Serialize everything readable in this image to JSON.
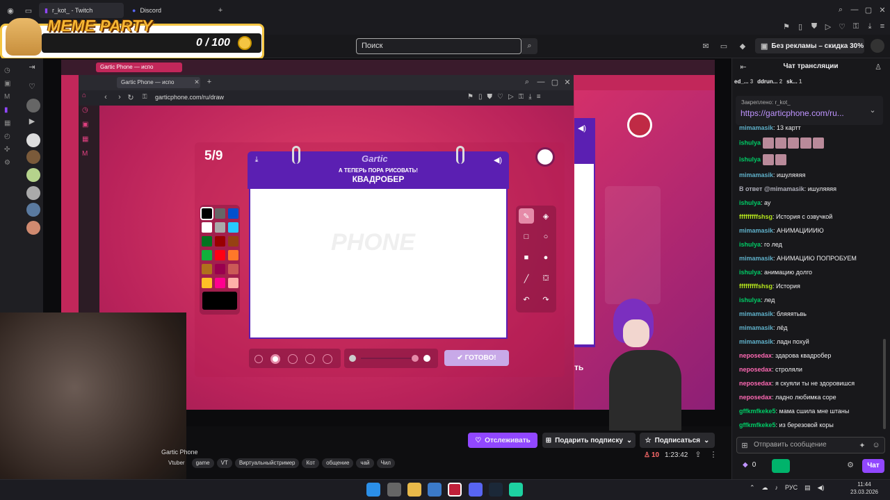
{
  "browser": {
    "tabs": [
      {
        "label": "r_kot_ - Twitch"
      },
      {
        "label": "Discord"
      }
    ],
    "new_tab": "+"
  },
  "meme_party": {
    "title": "MEME PARTY",
    "counter": "0 / 100"
  },
  "twitch": {
    "search_placeholder": "Поиск",
    "ad_free": "Без рекламы – скидка 30%"
  },
  "inner_browser": {
    "bg_tab": "Gartic Phone — испо",
    "tab": "Gartic Phone — испо",
    "url": "garticphone.com/ru/draw"
  },
  "game": {
    "round": "5/9",
    "logo": "Gartic",
    "subtitle": "А ТЕПЕРЬ ПОРА РИСОВАТЬ!",
    "word": "КВАДРОБЕР",
    "watermark": "PHONE",
    "done_label": "ГОТОВО!",
    "side_button_fragment": "ть",
    "palette": [
      "#000000",
      "#666666",
      "#0050cd",
      "#ffffff",
      "#aaaaaa",
      "#26c9ff",
      "#017420",
      "#990000",
      "#964112",
      "#11b03c",
      "#ff0013",
      "#ff7829",
      "#b0701c",
      "#99004e",
      "#cb5a57",
      "#ffc126",
      "#ff008f",
      "#feafa8"
    ],
    "tools": [
      "pen-icon",
      "eraser-icon",
      "square-icon",
      "circle-icon",
      "filled-square-icon",
      "filled-circle-icon",
      "line-icon",
      "fill-icon",
      "undo-icon",
      "redo-icon"
    ]
  },
  "stream": {
    "game_name": "Gartic Phone",
    "follow_label": "Отслеживать",
    "gift_label": "Подарить подписку",
    "subscribe_label": "Подписаться",
    "viewers": "10",
    "uptime": "1:23:42",
    "tags": [
      "Vtuber",
      "game",
      "VT",
      "Виртуальныйстример",
      "Кот",
      "общение",
      "чай",
      "Чил"
    ]
  },
  "chat": {
    "title": "Чат трансляции",
    "top_users": [
      {
        "name": "ed_...",
        "count": "3"
      },
      {
        "name": "ddrun...",
        "count": "2"
      },
      {
        "name": "sk...",
        "count": "1"
      }
    ],
    "pinned_label": "Закреплено: r_kot_",
    "pinned_link": "https://garticphone.com/ru...",
    "messages": [
      {
        "user": "mimamasik",
        "text": "13 картт",
        "color": "#5fb0c9"
      },
      {
        "user": "ishulya",
        "text": "",
        "color": "#00cc66"
      },
      {
        "user": "ishulya",
        "text": "",
        "color": "#00cc66"
      },
      {
        "user": "mimamasik",
        "text": "ишуляяяя",
        "color": "#5fb0c9"
      },
      {
        "user": "В ответ @mimamasik",
        "text": "ишуляяяя",
        "color": "#adadb8"
      },
      {
        "user": "ishulya",
        "text": "ау",
        "color": "#00cc66"
      },
      {
        "user": "fffffffffshsg",
        "text": "История с озвучкой",
        "color": "#b5e61d"
      },
      {
        "user": "mimamasik",
        "text": "АНИМАЦИИИЮ",
        "color": "#5fb0c9"
      },
      {
        "user": "ishulya",
        "text": "го лед",
        "color": "#00cc66"
      },
      {
        "user": "mimamasik",
        "text": "АНИМАЦИЮ ПОПРОБУЕМ",
        "color": "#5fb0c9"
      },
      {
        "user": "ishulya",
        "text": "анимацию долго",
        "color": "#00cc66"
      },
      {
        "user": "fffffffffshsg",
        "text": "История",
        "color": "#b5e61d"
      },
      {
        "user": "ishulya",
        "text": "лед",
        "color": "#00cc66"
      },
      {
        "user": "mimamasik",
        "text": "бляяятьвь",
        "color": "#5fb0c9"
      },
      {
        "user": "mimamasik",
        "text": "лёд",
        "color": "#5fb0c9"
      },
      {
        "user": "mimamasik",
        "text": "ладн похуй",
        "color": "#5fb0c9"
      },
      {
        "user": "neposedax",
        "text": "здарова квадробер",
        "color": "#ff69b4"
      },
      {
        "user": "neposedax",
        "text": "строляли",
        "color": "#ff69b4"
      },
      {
        "user": "neposedax",
        "text": "я скуяли ты не здоровишся",
        "color": "#ff69b4"
      },
      {
        "user": "neposedax",
        "text": "ладно любимка соре",
        "color": "#ff69b4"
      },
      {
        "user": "gffkmfkeke5",
        "text": "мама сшила мне штаны",
        "color": "#00cc66"
      },
      {
        "user": "gffkmfkeke5",
        "text": "из березовой коры",
        "color": "#00cc66"
      }
    ],
    "input_placeholder": "Отправить сообщение",
    "points": "0",
    "chat_button": "Чат"
  },
  "taskbar": {
    "lang": "РУС",
    "time": "11:44",
    "date": "23.03.2026"
  }
}
